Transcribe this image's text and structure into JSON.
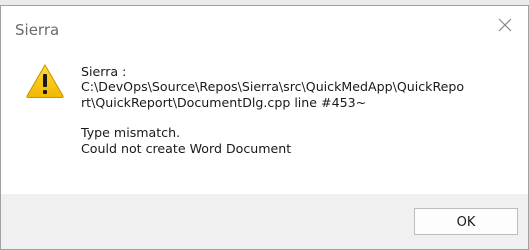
{
  "window": {
    "title": "Sierra"
  },
  "message": {
    "source": "Sierra :",
    "path_line1": "C:\\DevOps\\Source\\Repos\\Sierra\\src\\QuickMedApp\\QuickRepo",
    "path_line2": "rt\\QuickReport\\DocumentDlg.cpp line #453~",
    "error_line1": "Type mismatch.",
    "error_line2": "Could not create Word Document"
  },
  "buttons": {
    "ok_label": "OK"
  },
  "icons": {
    "message_icon": "warning-icon",
    "close_icon": "close-icon"
  },
  "colors": {
    "warning_fill": "#f5c400",
    "content_bg": "#ffffff",
    "footer_bg": "#f0f0f0"
  }
}
